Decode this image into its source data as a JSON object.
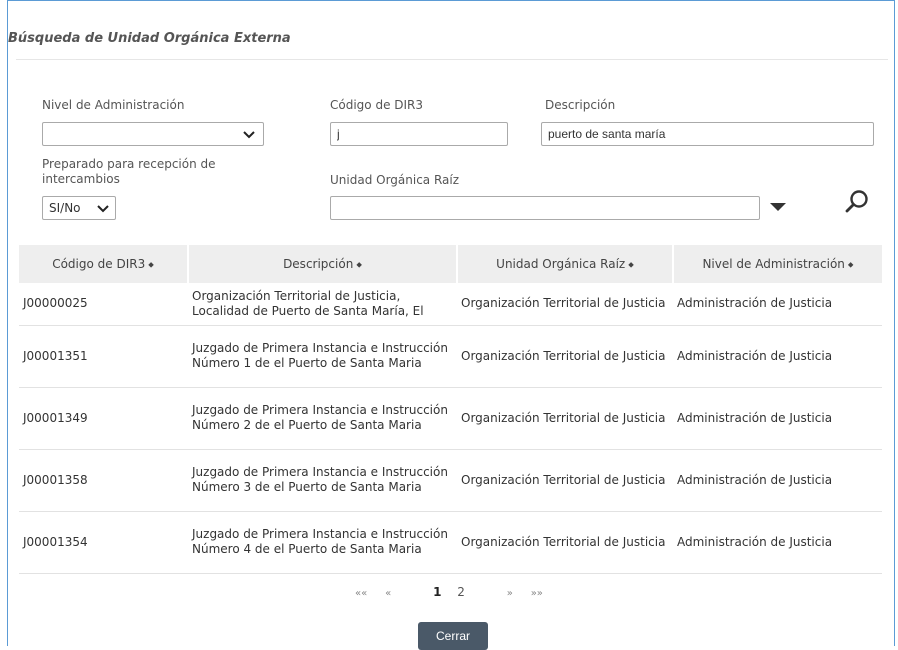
{
  "dialog": {
    "title": "Búsqueda de Unidad Orgánica Externa"
  },
  "form": {
    "nivel_label": "Nivel de Administración",
    "nivel_value": "",
    "codigo_label": "Código de DIR3",
    "codigo_value": "j",
    "descripcion_label": "Descripción",
    "descripcion_value": "puerto de santa maría",
    "preparado_label": "Preparado para recepción de intercambios",
    "preparado_value": "SI/No",
    "raiz_label": "Unidad Orgánica Raíz",
    "raiz_value": ""
  },
  "icons": {
    "search": "search-icon",
    "dropdown": "caret-down-icon",
    "chevron": "chevron-down-icon"
  },
  "table": {
    "headers": [
      "Código de DIR3",
      "Descripción",
      "Unidad Orgánica Raíz",
      "Nivel de Administración"
    ],
    "sort_glyph": "⬥",
    "rows": [
      {
        "codigo": "J00000025",
        "descripcion": "Organización Territorial de Justicia, Localidad de Puerto de Santa María, El",
        "raiz": "Organización Territorial de Justicia",
        "nivel": "Administración de Justicia"
      },
      {
        "codigo": "J00001351",
        "descripcion": "Juzgado de Primera Instancia e Instrucción Número 1 de el Puerto de Santa Maria",
        "raiz": "Organización Territorial de Justicia",
        "nivel": "Administración de Justicia"
      },
      {
        "codigo": "J00001349",
        "descripcion": "Juzgado de Primera Instancia e Instrucción Número 2 de el Puerto de Santa Maria",
        "raiz": "Organización Territorial de Justicia",
        "nivel": "Administración de Justicia"
      },
      {
        "codigo": "J00001358",
        "descripcion": "Juzgado de Primera Instancia e Instrucción Número 3 de el Puerto de Santa Maria",
        "raiz": "Organización Territorial de Justicia",
        "nivel": "Administración de Justicia"
      },
      {
        "codigo": "J00001354",
        "descripcion": "Juzgado de Primera Instancia e Instrucción Número 4 de el Puerto de Santa Maria",
        "raiz": "Organización Territorial de Justicia",
        "nivel": "Administración de Justicia"
      }
    ]
  },
  "pagination": {
    "first": "««",
    "prev": "«",
    "pages": [
      "1",
      "2"
    ],
    "current": "1",
    "next": "»",
    "last": "»»"
  },
  "actions": {
    "close_label": "Cerrar"
  },
  "colors": {
    "accent_border": "#5b9bd5",
    "button_bg": "#4a5968",
    "header_bg": "#eeeeee"
  }
}
